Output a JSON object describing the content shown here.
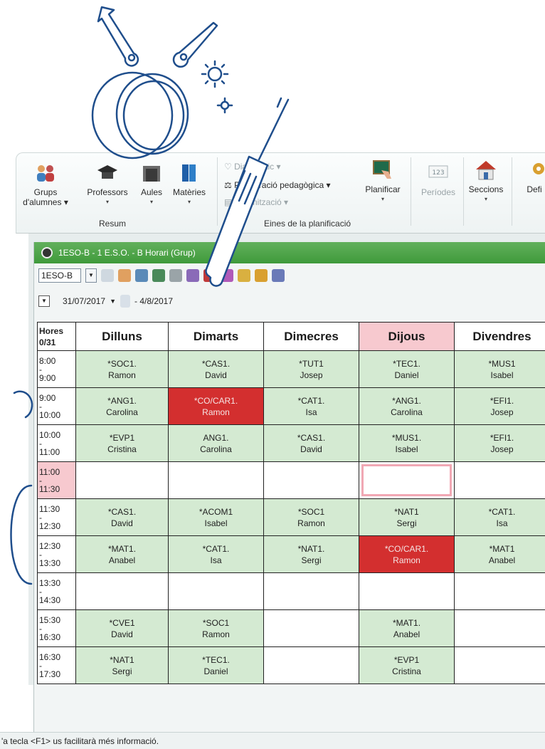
{
  "ribbon": {
    "grups_l1": "Grups",
    "grups_l2": "d'alumnes ▾",
    "professors": "Professors",
    "aules": "Aules",
    "materies": "Matèries",
    "group_resum": "Resum",
    "diagnostic": "Diagnòstic ▾",
    "ponderacio": "Ponderació pedagògica ▾",
    "optimitzacio": "Optimització ▾",
    "group_eines": "Eines de la planificació",
    "planificar": "Planificar",
    "periodes": "Períodes",
    "seccions": "Seccions",
    "defi": "Defi"
  },
  "window": {
    "title": "1ESO-B - 1 E.S.O. - B  Horari  (Grup)",
    "class_select": "1ESO-B",
    "date_start": "31/07/2017",
    "date_end": "- 4/8/2017"
  },
  "timetable": {
    "hours_header_l1": "Hores",
    "hours_header_l2": "0/31",
    "days": [
      "Dilluns",
      "Dimarts",
      "Dimecres",
      "Dijous",
      "Divendres"
    ],
    "rows": [
      {
        "time": "8:00\n-\n9:00",
        "cells": [
          {
            "subject": "*SOC1.",
            "teacher": "Ramon"
          },
          {
            "subject": "*CAS1.",
            "teacher": "David"
          },
          {
            "subject": "*TUT1",
            "teacher": "Josep"
          },
          {
            "subject": "*TEC1.",
            "teacher": "Daniel"
          },
          {
            "subject": "*MUS1",
            "teacher": "Isabel"
          }
        ]
      },
      {
        "time": "9:00\n-\n10:00",
        "cells": [
          {
            "subject": "*ANG1.",
            "teacher": "Carolina"
          },
          {
            "subject": "*CO/CAR1.",
            "teacher": "Ramon",
            "state": "red"
          },
          {
            "subject": "*CAT1.",
            "teacher": "Isa"
          },
          {
            "subject": "*ANG1.",
            "teacher": "Carolina"
          },
          {
            "subject": "*EFI1.",
            "teacher": "Josep"
          }
        ]
      },
      {
        "time": "10:00\n-\n11:00",
        "cells": [
          {
            "subject": "*EVP1",
            "teacher": "Cristina"
          },
          {
            "subject": "ANG1.",
            "teacher": "Carolina"
          },
          {
            "subject": "*CAS1.",
            "teacher": "David"
          },
          {
            "subject": "*MUS1.",
            "teacher": "Isabel"
          },
          {
            "subject": "*EFI1.",
            "teacher": "Josep"
          }
        ]
      },
      {
        "time": "11:00\n-\n11:30",
        "break": true,
        "cells": [
          {
            "state": "empty"
          },
          {
            "state": "empty"
          },
          {
            "state": "empty"
          },
          {
            "state": "selected"
          },
          {
            "state": "empty"
          }
        ]
      },
      {
        "time": "11:30\n-\n12:30",
        "cells": [
          {
            "subject": "*CAS1.",
            "teacher": "David"
          },
          {
            "subject": "*ACOM1",
            "teacher": "Isabel"
          },
          {
            "subject": "*SOC1",
            "teacher": "Ramon"
          },
          {
            "subject": "*NAT1",
            "teacher": "Sergi"
          },
          {
            "subject": "*CAT1.",
            "teacher": "Isa"
          }
        ]
      },
      {
        "time": "12:30\n-\n13:30",
        "cells": [
          {
            "subject": "*MAT1.",
            "teacher": "Anabel"
          },
          {
            "subject": "*CAT1.",
            "teacher": "Isa"
          },
          {
            "subject": "*NAT1.",
            "teacher": "Sergi"
          },
          {
            "subject": "*CO/CAR1.",
            "teacher": "Ramon",
            "state": "red"
          },
          {
            "subject": "*MAT1",
            "teacher": "Anabel"
          }
        ]
      },
      {
        "time": "13:30\n-\n14:30",
        "cells": [
          {
            "state": "empty"
          },
          {
            "state": "empty"
          },
          {
            "state": "empty"
          },
          {
            "state": "empty"
          },
          {
            "state": "empty"
          }
        ]
      },
      {
        "time": "15:30\n-\n16:30",
        "cells": [
          {
            "subject": "*CVE1",
            "teacher": "David"
          },
          {
            "subject": "*SOC1",
            "teacher": "Ramon"
          },
          {
            "state": "empty"
          },
          {
            "subject": "*MAT1.",
            "teacher": "Anabel"
          },
          {
            "state": "empty"
          }
        ]
      },
      {
        "time": "16:30\n-\n17:30",
        "cells": [
          {
            "subject": "*NAT1",
            "teacher": "Sergi"
          },
          {
            "subject": "*TEC1.",
            "teacher": "Daniel"
          },
          {
            "state": "empty"
          },
          {
            "subject": "*EVP1",
            "teacher": "Cristina"
          },
          {
            "state": "empty"
          }
        ]
      }
    ]
  },
  "status": "'a tecla <F1> us facilitarà més informació.",
  "colors": {
    "green_title": "#4ea548",
    "cell_green": "#d4ead2",
    "red": "#d32f2f",
    "pink": "#f7c9cf",
    "deco_blue": "#1f4e8c"
  }
}
